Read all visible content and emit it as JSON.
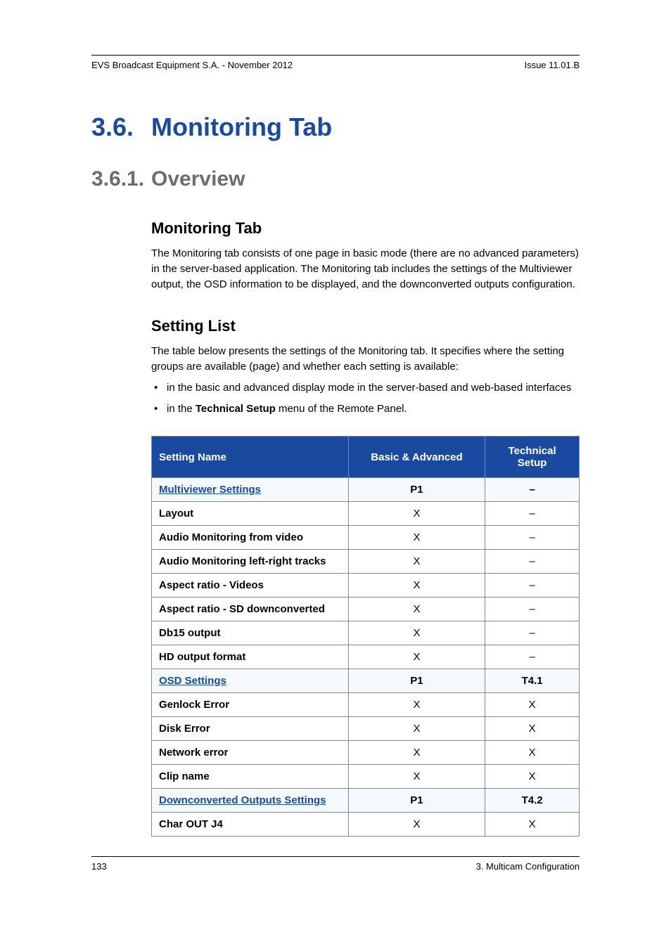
{
  "header": {
    "left": "EVS Broadcast Equipment S.A. - November 2012",
    "right": "Issue 11.01.B"
  },
  "h1": {
    "num": "3.6.",
    "text": "Monitoring Tab"
  },
  "h2": {
    "num": "3.6.1.",
    "text": "Overview"
  },
  "section1": {
    "title": "Monitoring Tab",
    "para": "The Monitoring tab consists of one page in basic mode (there are no advanced parameters) in the server-based application. The Monitoring tab includes the settings of the Multiviewer output, the OSD information to be displayed, and the downconverted outputs configuration."
  },
  "section2": {
    "title": "Setting List",
    "para": "The table below presents the settings of the Monitoring tab. It specifies where the setting groups are available (page) and whether each setting is available:",
    "bullet1": "in the basic and advanced display mode in the server-based and web-based interfaces",
    "bullet2_pre": "in the ",
    "bullet2_bold": "Technical Setup",
    "bullet2_post": " menu of the Remote Panel."
  },
  "table": {
    "headers": {
      "c1": "Setting Name",
      "c2": "Basic & Advanced",
      "c3": "Technical Setup"
    },
    "rows": [
      {
        "link": true,
        "c1": "Multiviewer Settings",
        "c2": "P1",
        "c3": "–"
      },
      {
        "link": false,
        "c1": "Layout",
        "c2": "X",
        "c3": "–"
      },
      {
        "link": false,
        "c1": "Audio Monitoring from video",
        "c2": "X",
        "c3": "–"
      },
      {
        "link": false,
        "c1": "Audio Monitoring left-right tracks",
        "c2": "X",
        "c3": "–"
      },
      {
        "link": false,
        "c1": "Aspect ratio - Videos",
        "c2": "X",
        "c3": "–"
      },
      {
        "link": false,
        "c1": "Aspect ratio - SD downconverted",
        "c2": "X",
        "c3": "–"
      },
      {
        "link": false,
        "c1": "Db15 output",
        "c2": "X",
        "c3": "–"
      },
      {
        "link": false,
        "c1": "HD output format",
        "c2": "X",
        "c3": "–"
      },
      {
        "link": true,
        "c1": "OSD Settings",
        "c2": "P1",
        "c3": "T4.1"
      },
      {
        "link": false,
        "c1": "Genlock Error",
        "c2": "X",
        "c3": "X"
      },
      {
        "link": false,
        "c1": "Disk Error",
        "c2": "X",
        "c3": "X"
      },
      {
        "link": false,
        "c1": "Network error",
        "c2": "X",
        "c3": "X"
      },
      {
        "link": false,
        "c1": "Clip name",
        "c2": "X",
        "c3": "X"
      },
      {
        "link": true,
        "c1": "Downconverted Outputs Settings",
        "c2": "P1",
        "c3": "T4.2"
      },
      {
        "link": false,
        "c1": "Char OUT J4",
        "c2": "X",
        "c3": "X"
      }
    ]
  },
  "footer": {
    "left": "133",
    "right": "3. Multicam Configuration"
  }
}
